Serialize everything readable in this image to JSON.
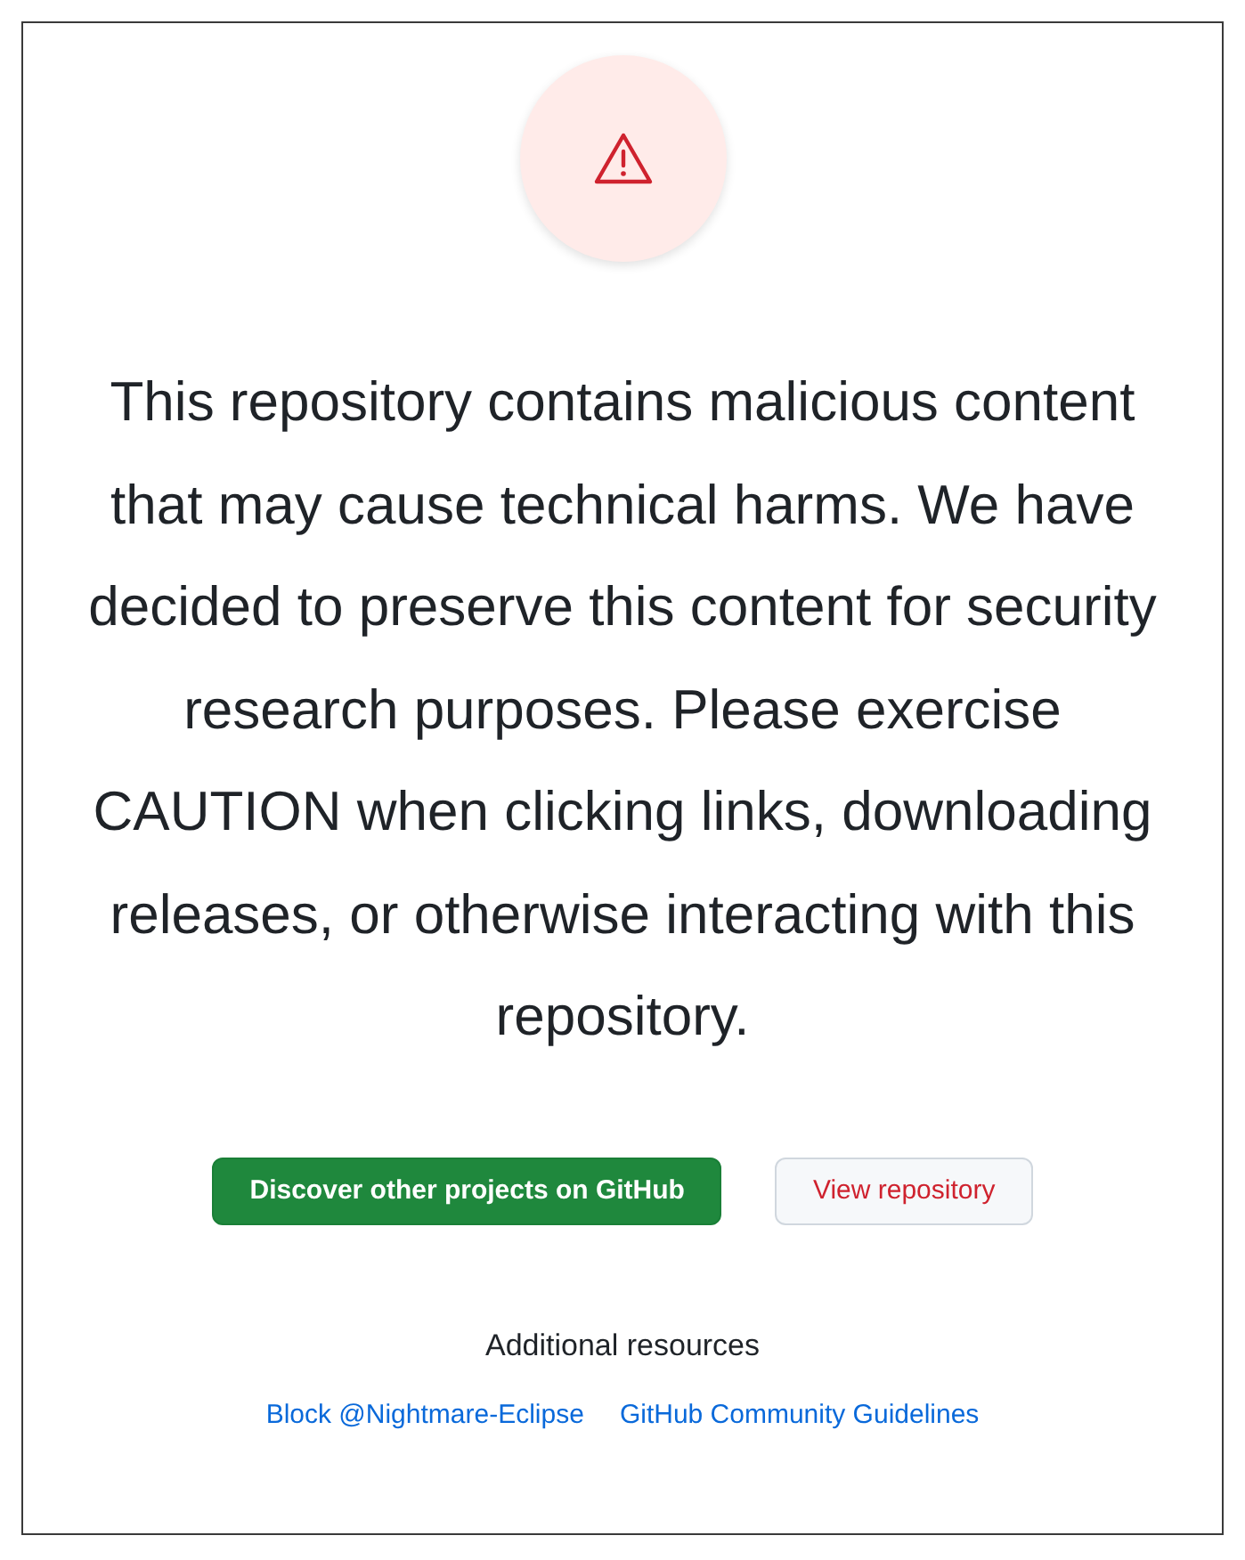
{
  "message": "This repository contains malicious content that may cause technical harms. We have decided to preserve this content for security research purposes. Please exercise CAUTION when clicking links, downloading releases, or otherwise interacting with this repository.",
  "buttons": [
    {
      "label": "Discover other projects on GitHub",
      "kind": "primary"
    },
    {
      "label": "View repository",
      "kind": "danger"
    }
  ],
  "resources": {
    "title": "Additional resources",
    "links": [
      "Block @Nightmare-Eclipse",
      "GitHub Community Guidelines"
    ]
  }
}
